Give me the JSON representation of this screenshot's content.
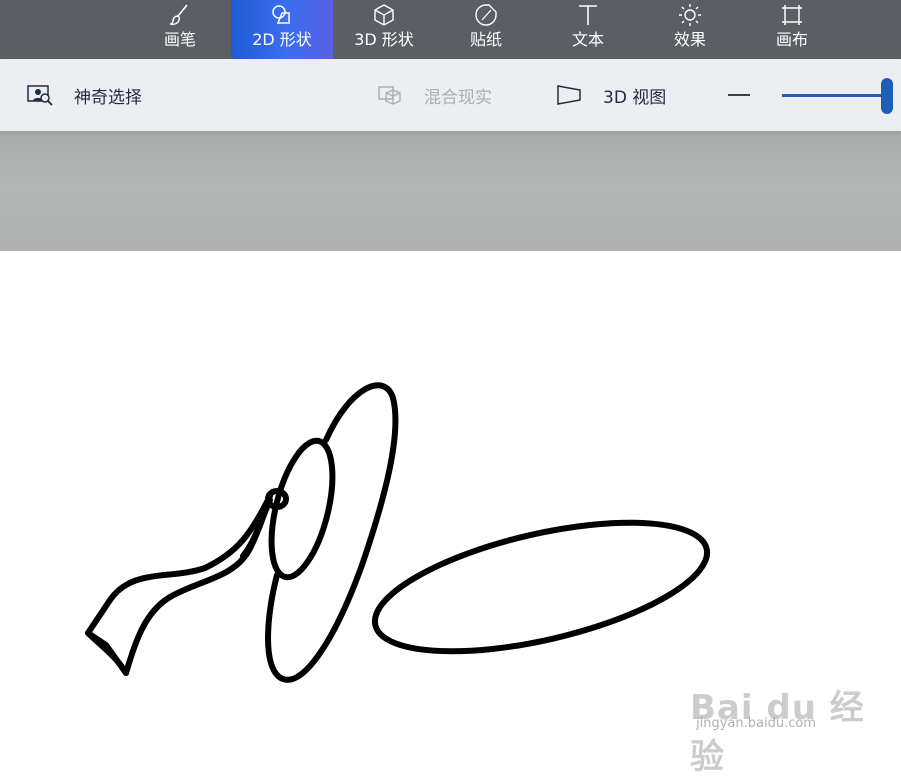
{
  "tabs": [
    {
      "label": "画笔",
      "icon": "brush-icon",
      "active": false
    },
    {
      "label": "2D 形状",
      "icon": "2d-shapes-icon",
      "active": true
    },
    {
      "label": "3D 形状",
      "icon": "3d-cube-icon",
      "active": false
    },
    {
      "label": "贴纸",
      "icon": "sticker-icon",
      "active": false
    },
    {
      "label": "文本",
      "icon": "text-icon",
      "active": false
    },
    {
      "label": "效果",
      "icon": "sun-effects-icon",
      "active": false
    },
    {
      "label": "画布",
      "icon": "canvas-crop-icon",
      "active": false
    }
  ],
  "toolbar": {
    "magic_select": "神奇选择",
    "mixed_reality": "混合现实",
    "view_3d": "3D 视图"
  },
  "zoom": {
    "value": 1.0
  },
  "watermark": {
    "logo": "Bai du 经验",
    "url": "jingyan.baidu.com"
  },
  "colors": {
    "tabbar": "#5b5e64",
    "active_tab": "#3b6df0",
    "accent": "#1e5fb8",
    "stroke": "#000000"
  }
}
